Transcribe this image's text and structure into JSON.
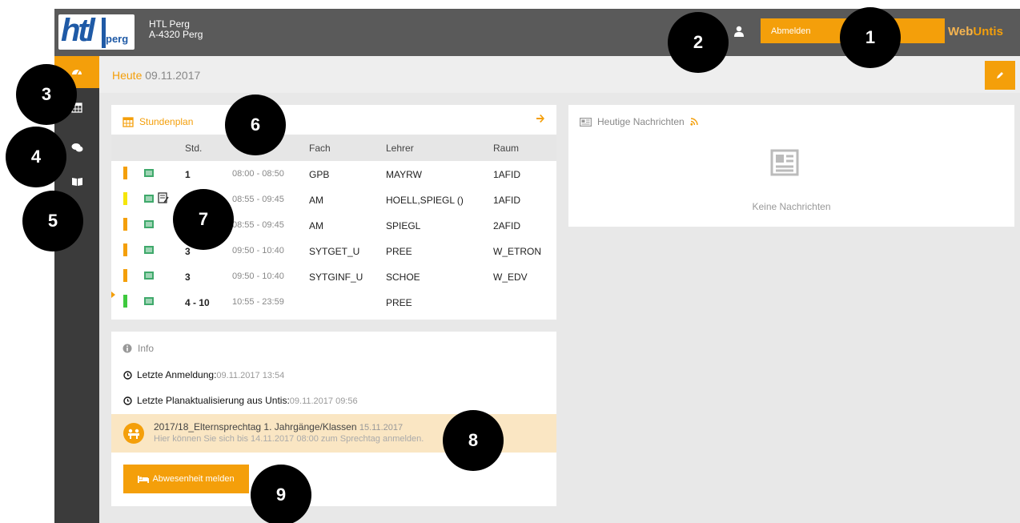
{
  "school": {
    "name": "HTL Perg",
    "address": "A-4320 Perg"
  },
  "logo": {
    "text": "htl",
    "sub": "perg"
  },
  "header": {
    "logout_label": "Abmelden",
    "brand_web": "Web",
    "brand_untis": "Untis"
  },
  "sidebar": {
    "items": [
      {
        "icon": "dashboard-icon",
        "active": true
      },
      {
        "icon": "calendar-icon",
        "active": false
      },
      {
        "icon": "messages-icon",
        "active": false
      },
      {
        "icon": "book-icon",
        "active": false
      }
    ]
  },
  "today": {
    "label": "Heute",
    "date": "09.11.2017"
  },
  "timetable": {
    "title": "Stundenplan",
    "columns": {
      "period": "Std.",
      "subject": "Fach",
      "teacher": "Lehrer",
      "room": "Raum"
    },
    "rows": [
      {
        "period": "1",
        "time": "08:00 - 08:50",
        "subject": "GPB",
        "teacher": "MAYRW",
        "room": "1AFID",
        "color": "#f49f0a",
        "note": false,
        "current": false
      },
      {
        "period": "",
        "time": "08:55 - 09:45",
        "subject": "AM",
        "teacher": "HOELL,SPIEGL ()",
        "room": "1AFID",
        "color": "#f5e60a",
        "note": true,
        "current": false
      },
      {
        "period": "",
        "time": "08:55 - 09:45",
        "subject": "AM",
        "teacher": "SPIEGL",
        "room": "2AFID",
        "color": "#f49f0a",
        "note": false,
        "current": false
      },
      {
        "period": "3",
        "time": "09:50 - 10:40",
        "subject": "SYTGET_U",
        "teacher": "PREE",
        "room": "W_ETRON",
        "color": "#f49f0a",
        "note": false,
        "current": false
      },
      {
        "period": "3",
        "time": "09:50 - 10:40",
        "subject": "SYTGINF_U",
        "teacher": "SCHOE",
        "room": "W_EDV",
        "color": "#f49f0a",
        "note": false,
        "current": false
      },
      {
        "period": "4 - 10",
        "time": "10:55 - 23:59",
        "subject": "",
        "teacher": "PREE",
        "room": "",
        "color": "#3ec93e",
        "note": false,
        "current": true
      }
    ]
  },
  "info": {
    "title": "Info",
    "last_login_label": "Letzte Anmeldung:",
    "last_login_value": "09.11.2017 13:54",
    "last_update_label": "Letzte Planaktualisierung aus Untis:",
    "last_update_value": "09.11.2017 09:56",
    "event_title": "2017/18_Elternsprechtag 1. Jahrgänge/Klassen",
    "event_date": "15.11.2017",
    "event_text": "Hier können Sie sich bis 14.11.2017 08:00 zum Sprechtag anmelden.",
    "absence_button": "Abwesenheit melden"
  },
  "news": {
    "title": "Heutige Nachrichten",
    "empty": "Keine Nachrichten"
  },
  "annotations": [
    "1",
    "2",
    "3",
    "4",
    "5",
    "6",
    "7",
    "8",
    "9"
  ],
  "colors": {
    "accent": "#f49f0a",
    "topbar": "#5a5a5a",
    "sidebar": "#3b3b3b",
    "event_bg": "#fae6c3"
  }
}
